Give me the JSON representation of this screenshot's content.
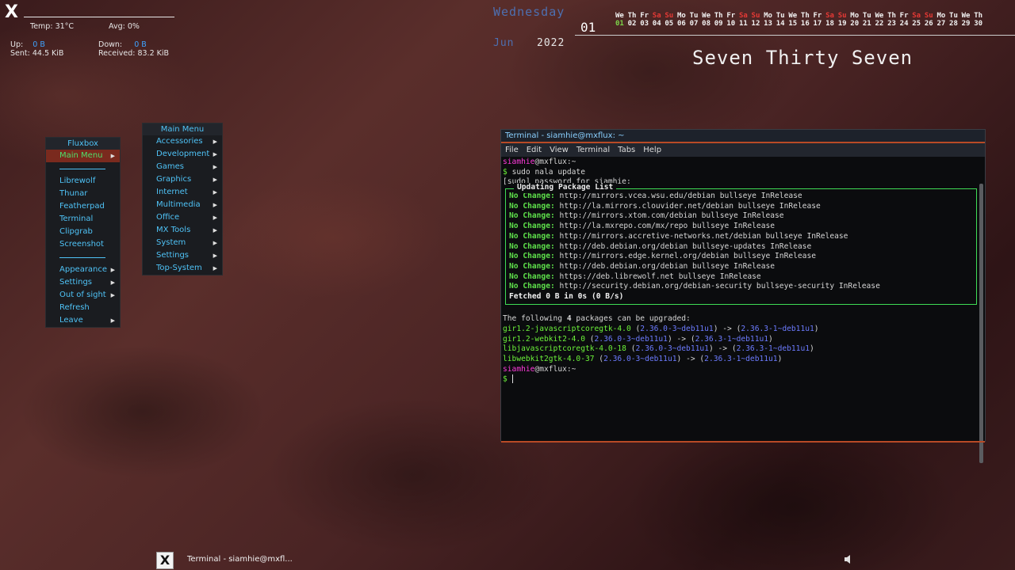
{
  "conky": {
    "logo": "X",
    "temp_label": "Temp:",
    "temp_value": "31°C",
    "avg_label": "Avg:",
    "avg_value": "0%",
    "up_label": "Up:",
    "up_value": "0 B",
    "down_label": "Down:",
    "down_value": "0 B",
    "sent_label": "Sent:",
    "sent_value": "44.5 KiB",
    "received_label": "Received:",
    "received_value": "83.2 KiB"
  },
  "date": {
    "weekday": "Wednesday",
    "day": "01",
    "month": "Jun",
    "year": "2022",
    "time_words": "Seven Thirty Seven"
  },
  "calendar": {
    "weekdays": [
      "We",
      "Th",
      "Fr",
      "Sa",
      "Su",
      "Mo",
      "Tu",
      "We",
      "Th",
      "Fr",
      "Sa",
      "Su",
      "Mo",
      "Tu",
      "We",
      "Th",
      "Fr",
      "Sa",
      "Su",
      "Mo",
      "Tu",
      "We",
      "Th",
      "Fr",
      "Sa",
      "Su",
      "Mo",
      "Tu",
      "We",
      "Th"
    ],
    "days": [
      "01",
      "02",
      "03",
      "04",
      "05",
      "06",
      "07",
      "08",
      "09",
      "10",
      "11",
      "12",
      "13",
      "14",
      "15",
      "16",
      "17",
      "18",
      "19",
      "20",
      "21",
      "22",
      "23",
      "24",
      "25",
      "26",
      "27",
      "28",
      "29",
      "30"
    ],
    "weekend_color": "#e53935",
    "today_color": "#7cd64a"
  },
  "fluxbox_menu": {
    "title": "Fluxbox",
    "items": [
      {
        "label": "Main Menu",
        "submenu": true,
        "active": true
      },
      {
        "separator": true
      },
      {
        "label": "Librewolf"
      },
      {
        "label": "Thunar"
      },
      {
        "label": "Featherpad"
      },
      {
        "label": "Terminal"
      },
      {
        "label": "Clipgrab"
      },
      {
        "label": "Screenshot"
      },
      {
        "separator": true
      },
      {
        "label": "Appearance",
        "submenu": true
      },
      {
        "label": "Settings",
        "submenu": true
      },
      {
        "label": "Out of sight",
        "submenu": true
      },
      {
        "label": "Refresh"
      },
      {
        "label": "Leave",
        "submenu": true
      }
    ]
  },
  "main_menu": {
    "title": "Main Menu",
    "items": [
      {
        "label": "Accessories"
      },
      {
        "label": "Development"
      },
      {
        "label": "Games"
      },
      {
        "label": "Graphics"
      },
      {
        "label": "Internet"
      },
      {
        "label": "Multimedia"
      },
      {
        "label": "Office"
      },
      {
        "label": "MX Tools"
      },
      {
        "label": "System"
      },
      {
        "label": "Settings"
      },
      {
        "label": "Top-System"
      }
    ]
  },
  "terminal": {
    "title": "Terminal - siamhie@mxflux: ~",
    "menu": [
      "File",
      "Edit",
      "View",
      "Terminal",
      "Tabs",
      "Help"
    ],
    "prompt_user": "siamhie",
    "prompt_host": "@mxflux",
    "prompt_path": ":~",
    "command": "sudo nala update",
    "sudo_prompt": "[sudo] password for siamhie:",
    "box_title": "Updating Package List",
    "no_change_label": "No Change:",
    "repos": [
      "http://mirrors.vcea.wsu.edu/debian bullseye InRelease",
      "http://la.mirrors.clouvider.net/debian bullseye InRelease",
      "http://mirrors.xtom.com/debian bullseye InRelease",
      "http://la.mxrepo.com/mx/repo bullseye InRelease",
      "http://mirrors.accretive-networks.net/debian bullseye InRelease",
      "http://deb.debian.org/debian bullseye-updates InRelease",
      "http://mirrors.edge.kernel.org/debian bullseye InRelease",
      "http://deb.debian.org/debian bullseye InRelease",
      "https://deb.librewolf.net bullseye InRelease",
      "http://security.debian.org/debian-security bullseye-security InRelease"
    ],
    "fetched": "Fetched 0 B in 0s (0 B/s)",
    "upgrade_prefix": "The following ",
    "upgrade_count": "4",
    "upgrade_suffix": " packages can be upgraded:",
    "packages": [
      {
        "name": "gir1.2-javascriptcoregtk-4.0",
        "from": "2.36.0-3~deb11u1",
        "to": "2.36.3-1~deb11u1"
      },
      {
        "name": "gir1.2-webkit2-4.0",
        "from": "2.36.0-3~deb11u1",
        "to": "2.36.3-1~deb11u1"
      },
      {
        "name": "libjavascriptcoregtk-4.0-18",
        "from": "2.36.0-3~deb11u1",
        "to": "2.36.3-1~deb11u1"
      },
      {
        "name": "libwebkit2gtk-4.0-37",
        "from": "2.36.0-3~deb11u1",
        "to": "2.36.3-1~deb11u1"
      }
    ]
  },
  "taskbar": {
    "logo": "X",
    "task_label": "Terminal - siamhie@mxfl..."
  }
}
